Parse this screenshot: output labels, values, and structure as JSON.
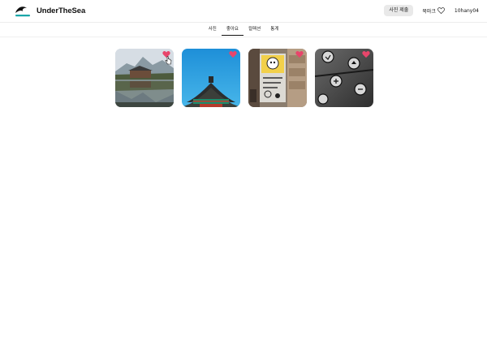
{
  "header": {
    "brand": "UnderTheSea",
    "submit_label": "사진 제출",
    "bookmark_label": "북마크",
    "username": "10hany04"
  },
  "tabs": [
    {
      "label": "사진",
      "active": false
    },
    {
      "label": "좋아요",
      "active": true
    },
    {
      "label": "컬렉션",
      "active": false
    },
    {
      "label": "통계",
      "active": false
    }
  ],
  "photos": [
    {
      "subject": "mountain-palace-reflection",
      "liked": true
    },
    {
      "subject": "palace-roof-blue-sky",
      "liked": true
    },
    {
      "subject": "street-art-wall",
      "liked": true
    },
    {
      "subject": "icon-stickers-glass",
      "liked": true
    }
  ],
  "colors": {
    "heart": "#e8456b",
    "logo_accent": "#1aa6a8",
    "submit_bg": "#e9e9e9"
  },
  "icons": [
    "logo-wave-icon",
    "heart-outline-icon",
    "heart-filled-icon",
    "pointer-cursor-icon"
  ]
}
